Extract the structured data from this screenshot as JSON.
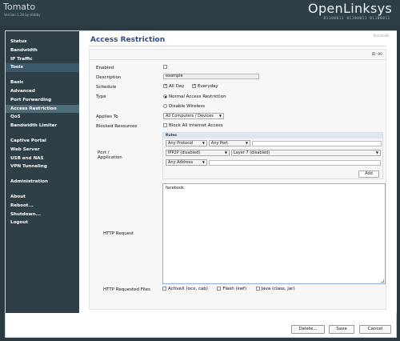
{
  "header": {
    "brand": "Tomato",
    "version": "Version 1.28 by shibby",
    "logo": "OpenLinksys",
    "binary": "01100011 01100011 01100011"
  },
  "sidebar": {
    "group1": [
      "Status",
      "Bandwidth",
      "IP Traffic",
      "Tools"
    ],
    "group2": [
      "Basic",
      "Advanced",
      "Port Forwarding",
      "Access Restriction",
      "QoS",
      "Bandwidth Limiter"
    ],
    "group3": [
      "Captive Portal",
      "Web Server",
      "USB and NAS",
      "VPN Tunneling"
    ],
    "group4": [
      "Administration"
    ],
    "group5": [
      "About",
      "Reboot...",
      "Shutdown...",
      "Logout"
    ]
  },
  "main": {
    "title": "Access Restriction",
    "tomato_id": "TomatoSB",
    "id_label": "ID: 00",
    "labels": {
      "enabled": "Enabled",
      "description": "Description",
      "schedule": "Schedule",
      "type": "Type",
      "applies_to": "Applies To",
      "blocked_resources": "Blocked Resources",
      "port_application": "Port /\nApplication",
      "http_request": "HTTP Request",
      "http_requested_files": "HTTP Requested Files"
    },
    "description_value": "example",
    "schedule": {
      "all_day": "All Day",
      "everyday": "Everyday"
    },
    "type": {
      "normal": "Normal Access Restriction",
      "disable_wireless": "Disable Wireless"
    },
    "applies_to_value": "All Computers / Devices",
    "block_all_internet": "Block All Internet Access",
    "rules": {
      "header": "Rules",
      "protocol": "Any Protocol",
      "port": "Any Port",
      "ipp2p": "IPP2P (disabled)",
      "layer7": "Layer 7 (disabled)",
      "address": "Any Address",
      "add_button": "Add"
    },
    "http_request_value": "facebook",
    "files": {
      "activex": "ActiveX (ocx, cab)",
      "flash": "Flash (swf)",
      "java": "Java (class, jar)"
    }
  },
  "footer": {
    "delete_label": "Delete...",
    "save_label": "Save",
    "cancel_label": "Cancel"
  }
}
